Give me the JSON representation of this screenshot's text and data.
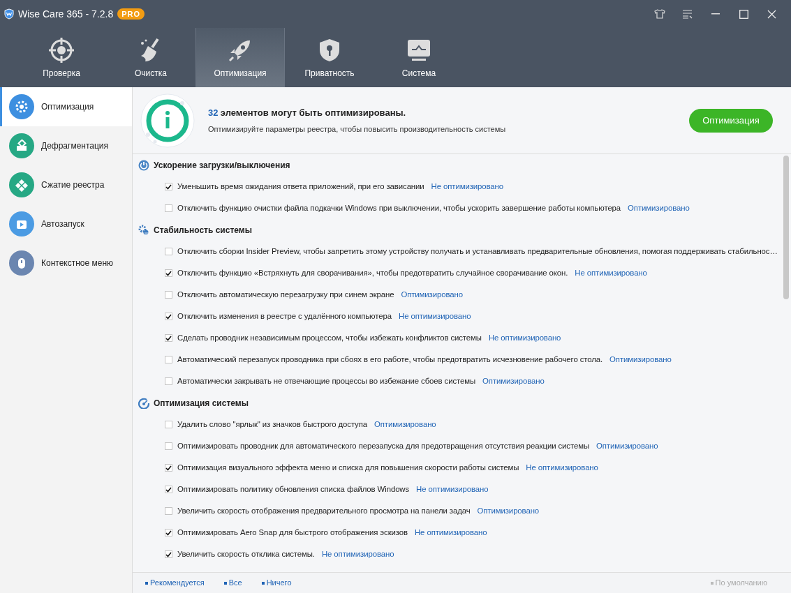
{
  "window": {
    "title": "Wise Care 365 - 7.2.8",
    "badge": "PRO"
  },
  "tabs": [
    {
      "label": "Проверка",
      "kind": "target",
      "selected": false
    },
    {
      "label": "Очистка",
      "kind": "broom",
      "selected": false
    },
    {
      "label": "Оптимизация",
      "kind": "rocket",
      "selected": true
    },
    {
      "label": "Приватность",
      "kind": "shield",
      "selected": false
    },
    {
      "label": "Система",
      "kind": "monitor",
      "selected": false
    }
  ],
  "sidebar": {
    "items": [
      {
        "label": "Оптимизация",
        "kind": "gear",
        "color": "#3d8fe0",
        "selected": true
      },
      {
        "label": "Дефрагментация",
        "kind": "disk",
        "color": "#26a884",
        "selected": false
      },
      {
        "label": "Сжатие реестра",
        "kind": "blocks",
        "color": "#26a884",
        "selected": false
      },
      {
        "label": "Автозапуск",
        "kind": "play",
        "color": "#4b9be3",
        "selected": false
      },
      {
        "label": "Контекстное меню",
        "kind": "mouse",
        "color": "#6b86b0",
        "selected": false
      }
    ]
  },
  "summary": {
    "count": "32",
    "headline": "элементов могут быть оптимизированы.",
    "description": "Оптимизируйте параметры реестра, чтобы повысить производительность системы",
    "button": "Оптимизация"
  },
  "sections": [
    {
      "title": "Ускорение загрузки/выключения",
      "kind": "power",
      "items": [
        {
          "label": "Уменьшить время ожидания ответа приложений, при его зависании",
          "status": "Не оптимизировано",
          "checked": true
        },
        {
          "label": "Отключить функцию очистки файла подкачки Windows при выключении, чтобы ускорить завершение работы компьютера",
          "status": "Оптимизировано",
          "checked": false
        }
      ]
    },
    {
      "title": "Стабильность системы",
      "kind": "gears",
      "items": [
        {
          "label": "Отключить сборки Insider Preview, чтобы запретить этому устройству получать и устанавливать предварительные обновления, помогая поддерживать стабильнос…",
          "checked": false
        },
        {
          "label": "Отключить функцию «Встряхнуть для сворачивания», чтобы предотвратить случайное сворачивание окон.",
          "status": "Не оптимизировано",
          "checked": true
        },
        {
          "label": "Отключить автоматическую перезагрузку при синем экране",
          "status": "Оптимизировано",
          "checked": false
        },
        {
          "label": "Отключить изменения в реестре с удалённого компьютера",
          "status": "Не оптимизировано",
          "checked": true
        },
        {
          "label": "Сделать проводник независимым процессом, чтобы избежать конфликтов системы",
          "status": "Не оптимизировано",
          "checked": true
        },
        {
          "label": "Автоматический перезапуск проводника при сбоях в его работе, чтобы предотвратить исчезновение рабочего стола.",
          "status": "Оптимизировано",
          "checked": false
        },
        {
          "label": "Автоматически закрывать не отвечающие процессы во избежание сбоев системы",
          "status": "Оптимизировано",
          "checked": false
        }
      ]
    },
    {
      "title": "Оптимизация системы",
      "kind": "gauge",
      "items": [
        {
          "label": "Удалить слово \"ярлык\" из значков быстрого доступа",
          "status": "Оптимизировано",
          "checked": false
        },
        {
          "label": "Оптимизировать проводник для автоматического перезапуска для предотвращения отсутствия реакции системы",
          "status": "Оптимизировано",
          "checked": false
        },
        {
          "label": "Оптимизация визуального эффекта меню и списка для повышения скорости работы системы",
          "status": "Не оптимизировано",
          "checked": true
        },
        {
          "label": "Оптимизировать политику обновления списка файлов Windows",
          "status": "Не оптимизировано",
          "checked": true
        },
        {
          "label": "Увеличить скорость отображения предварительного просмотра на панели задач",
          "status": "Оптимизировано",
          "checked": false
        },
        {
          "label": "Оптимизировать Aero Snap для быстрого отображения эскизов",
          "status": "Не оптимизировано",
          "checked": true
        },
        {
          "label": "Увеличить скорость отклика системы.",
          "status": "Не оптимизировано",
          "checked": true
        }
      ]
    }
  ],
  "footer": {
    "links": [
      "Рекомендуется",
      "Все",
      "Ничего"
    ],
    "default": "По умолчанию"
  }
}
